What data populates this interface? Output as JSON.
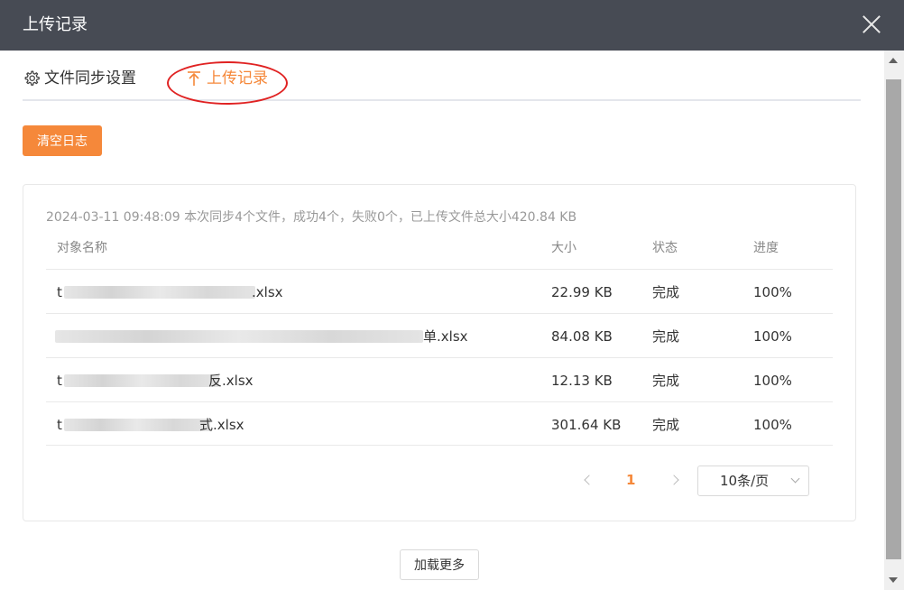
{
  "window": {
    "title": "上传记录"
  },
  "tabs": [
    {
      "label": "文件同步设置",
      "icon": "gear-icon"
    },
    {
      "label": "上传记录",
      "icon": "upload-arrow-icon",
      "active": true
    }
  ],
  "actions": {
    "clear_log": "清空日志",
    "load_more": "加载更多"
  },
  "record": {
    "summary": "2024-03-11 09:48:09  本次同步4个文件，成功4个，失败0个，已上传文件总大小420.84 KB",
    "columns": [
      "对象名称",
      "大小",
      "状态",
      "进度"
    ],
    "rows": [
      {
        "name_prefix": "t",
        "name_suffix": ".xlsx",
        "size": "22.99 KB",
        "status": "完成",
        "progress": "100%"
      },
      {
        "name_prefix": "",
        "name_suffix": "单.xlsx",
        "size": "84.08 KB",
        "status": "完成",
        "progress": "100%"
      },
      {
        "name_prefix": "t",
        "name_suffix": "反.xlsx",
        "size": "12.13 KB",
        "status": "完成",
        "progress": "100%"
      },
      {
        "name_prefix": "t",
        "name_suffix": "式.xlsx",
        "size": "301.64 KB",
        "status": "完成",
        "progress": "100%"
      }
    ]
  },
  "pagination": {
    "current": "1",
    "page_size": "10条/页"
  },
  "colors": {
    "accent": "#f5883a",
    "titlebar": "#474b54",
    "annotation": "#e02222"
  }
}
